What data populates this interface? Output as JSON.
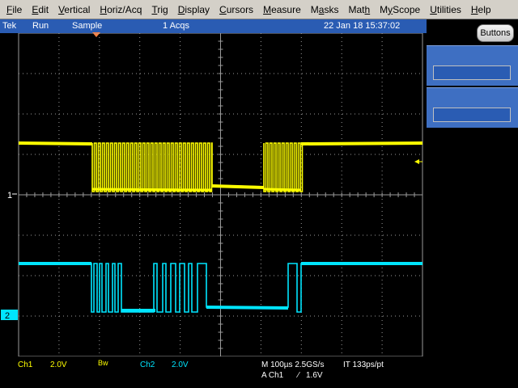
{
  "menu": {
    "items": [
      {
        "label": "File",
        "u": "F",
        "rest": "ile"
      },
      {
        "label": "Edit",
        "u": "E",
        "rest": "dit"
      },
      {
        "label": "Vertical",
        "u": "V",
        "rest": "ertical"
      },
      {
        "label": "Horiz/Acq",
        "u": "H",
        "rest": "oriz/Acq"
      },
      {
        "label": "Trig",
        "u": "T",
        "rest": "rig"
      },
      {
        "label": "Display",
        "u": "D",
        "rest": "isplay"
      },
      {
        "label": "Cursors",
        "u": "C",
        "rest": "ursors"
      },
      {
        "label": "Measure",
        "u": "M",
        "rest": "easure"
      },
      {
        "label": "Masks",
        "u": "a",
        "pre": "M",
        "rest": "sks"
      },
      {
        "label": "Math",
        "u": "h",
        "pre": "Mat",
        "rest": ""
      },
      {
        "label": "MyScope",
        "u": "y",
        "pre": "M",
        "rest": "Scope"
      },
      {
        "label": "Utilities",
        "u": "U",
        "rest": "tilities"
      },
      {
        "label": "Help",
        "u": "H",
        "rest": "elp"
      }
    ]
  },
  "status": {
    "brand": "Tek",
    "state": "Run",
    "mode": "Sample",
    "acqs": "1 Acqs",
    "datetime": "22 Jan 18 15:37:02"
  },
  "right_panel": {
    "buttons_label": "Buttons"
  },
  "channels": {
    "ch1_marker": "1",
    "ch2_marker": "2"
  },
  "readout": {
    "ch1_label": "Ch1",
    "ch1_scale": "2.0V",
    "bw_label": "Bw",
    "ch2_label": "Ch2",
    "ch2_scale": "2.0V",
    "timebase": "M 100µs 2.5GS/s",
    "interp": "IT 133ps/pt",
    "trigger_src": "A  Ch1",
    "trigger_slope": "⁄",
    "trigger_level": "1.6V"
  },
  "colors": {
    "ch1": "#ffff00",
    "ch2": "#00e5ff",
    "grid": "#9a9a9a",
    "status_bg": "#2a5cb3"
  }
}
